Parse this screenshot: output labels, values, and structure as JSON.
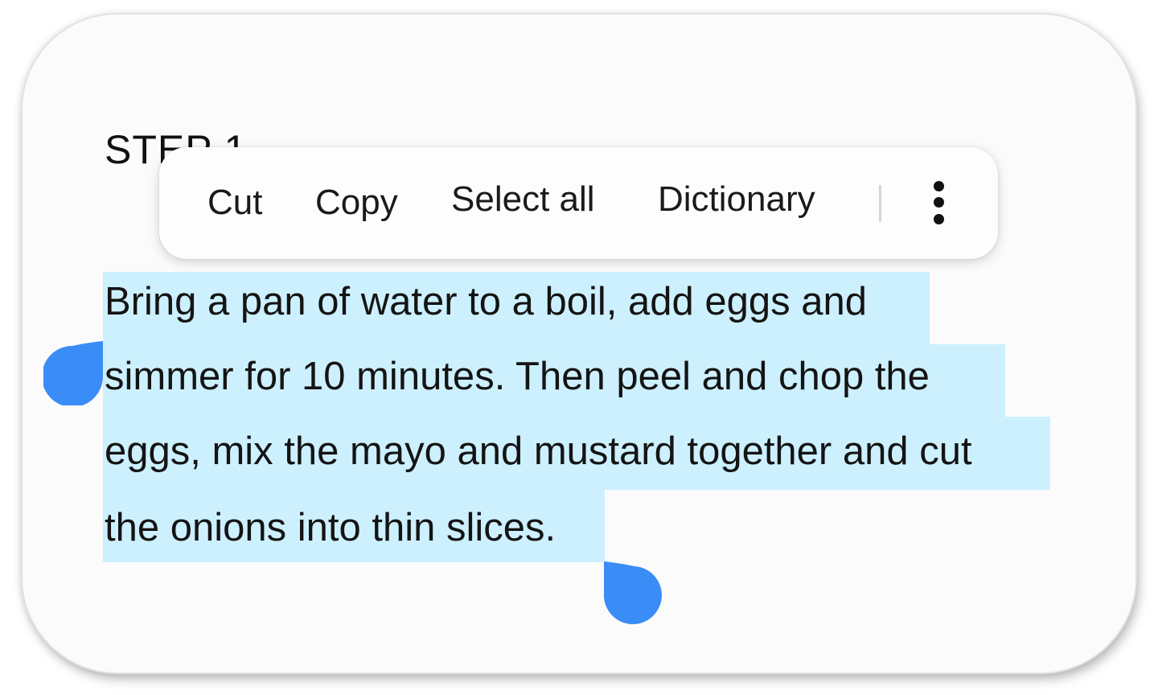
{
  "step": {
    "title": "STEP 1"
  },
  "selection_menu": {
    "items": [
      {
        "label": "Cut"
      },
      {
        "label": "Copy"
      },
      {
        "label": "Select all"
      },
      {
        "label": "Dictionary"
      }
    ],
    "more_icon": "vertical-ellipsis-icon"
  },
  "content": {
    "lines": [
      "Bring a pan of water to a boil, add eggs and",
      "simmer for 10 minutes. Then peel and chop the",
      "eggs, mix the mayo and mustard together and cut",
      "the onions into thin slices."
    ]
  },
  "colors": {
    "selection_highlight": "#cdf0fe",
    "handle": "#3a8cf6",
    "text": "#141414"
  },
  "handles": {
    "start_icon": "selection-start-handle",
    "end_icon": "selection-end-handle"
  }
}
